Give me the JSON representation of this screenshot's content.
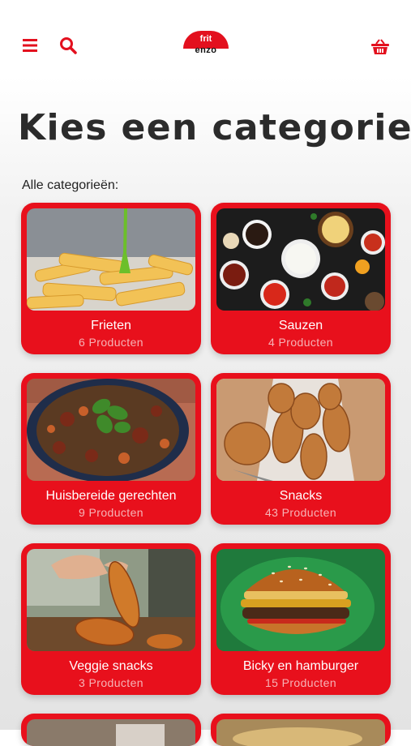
{
  "header": {
    "menu_icon": "menu-icon",
    "search_icon": "search-icon",
    "cart_icon": "basket-icon",
    "logo_top": "frit",
    "logo_bottom": "enzo",
    "brand_color": "#e3101e"
  },
  "page": {
    "title": "Kies een categorie",
    "subtitle": "Alle categorieën:"
  },
  "categories": [
    {
      "name": "Frieten",
      "count": "6 Producten"
    },
    {
      "name": "Sauzen",
      "count": "4 Producten"
    },
    {
      "name": "Huisbereide gerechten",
      "count": "9 Producten"
    },
    {
      "name": "Snacks",
      "count": "43 Producten"
    },
    {
      "name": "Veggie snacks",
      "count": "3 Producten"
    },
    {
      "name": "Bicky en hamburger",
      "count": "15 Producten"
    }
  ]
}
